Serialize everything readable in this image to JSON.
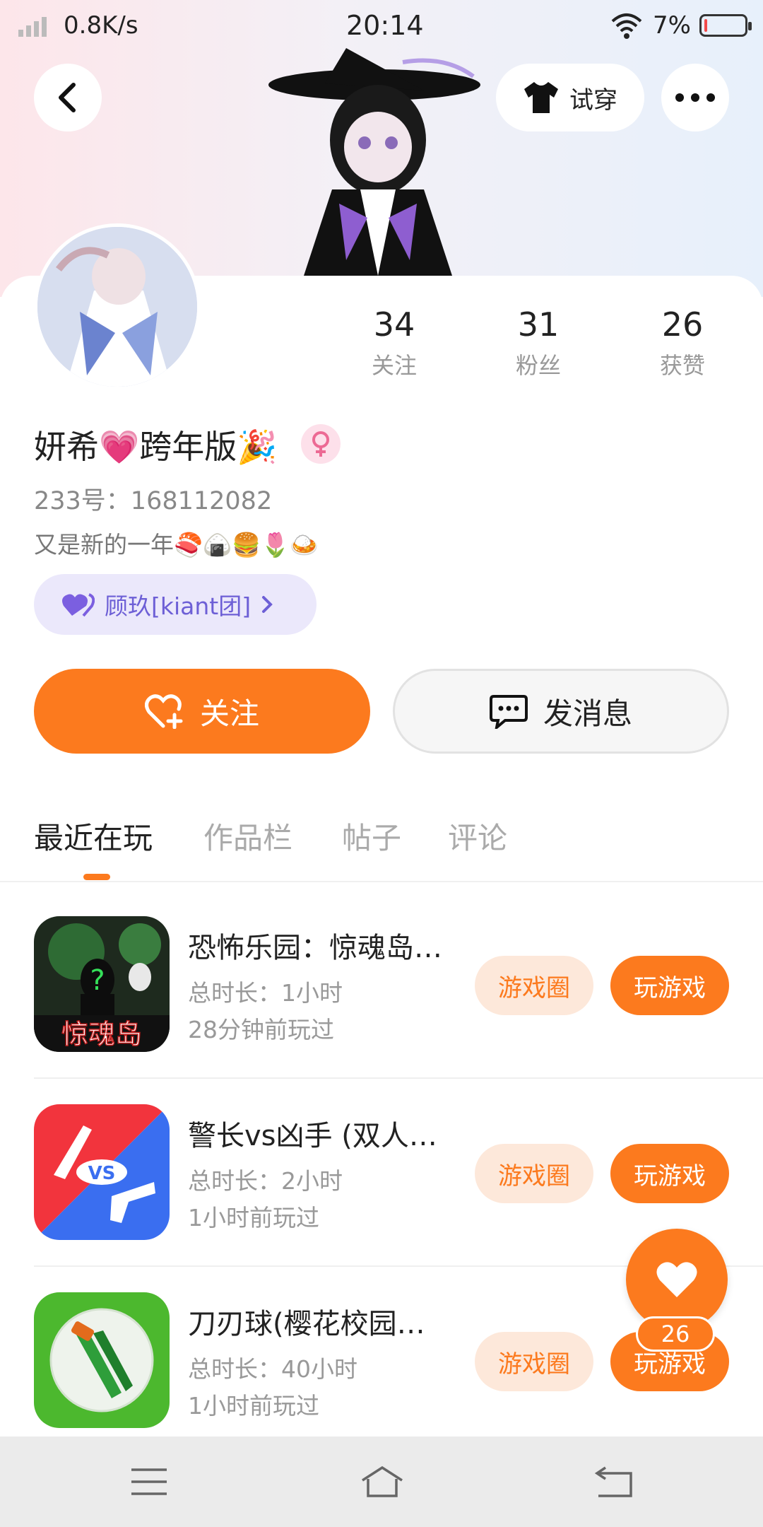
{
  "status_bar": {
    "network_speed": "0.8K/s",
    "time": "20:14",
    "battery_percent": "7%",
    "battery_level": 0.07
  },
  "header": {
    "try_on_label": "试穿"
  },
  "profile": {
    "stats": [
      {
        "value": "34",
        "label": "关注"
      },
      {
        "value": "31",
        "label": "粉丝"
      },
      {
        "value": "26",
        "label": "获赞"
      }
    ],
    "username": "妍希💗跨年版🎉",
    "user_id": "233号：168112082",
    "bio": "又是新的一年🍣🍙🍔🌷🍛",
    "group_name": "顾玖[kiant团]",
    "follow_label": "关注",
    "message_label": "发消息"
  },
  "tabs": [
    {
      "label": "最近在玩",
      "active": true
    },
    {
      "label": "作品栏",
      "active": false
    },
    {
      "label": "帖子",
      "active": false
    },
    {
      "label": "评论",
      "active": false
    }
  ],
  "games": [
    {
      "name": "恐怖乐园：惊魂岛…",
      "duration": "总时长：1小时",
      "last_played": "28分钟前玩过",
      "circle_label": "游戏圈",
      "play_label": "玩游戏",
      "icon_text": "惊魂岛"
    },
    {
      "name": "警长vs凶手 (双人…",
      "duration": "总时长：2小时",
      "last_played": "1小时前玩过",
      "circle_label": "游戏圈",
      "play_label": "玩游戏",
      "icon_text": "VS"
    },
    {
      "name": "刀刃球(樱花校园…",
      "duration": "总时长：40小时",
      "last_played": "1小时前玩过",
      "circle_label": "游戏圈",
      "play_label": "玩游戏",
      "icon_text": ""
    }
  ],
  "floating_like": {
    "count": "26"
  },
  "colors": {
    "accent": "#fc7a1e",
    "accent_light": "#fde8da",
    "group_pill_bg": "#ebe8fb",
    "group_pill_text": "#6d5fd6"
  }
}
